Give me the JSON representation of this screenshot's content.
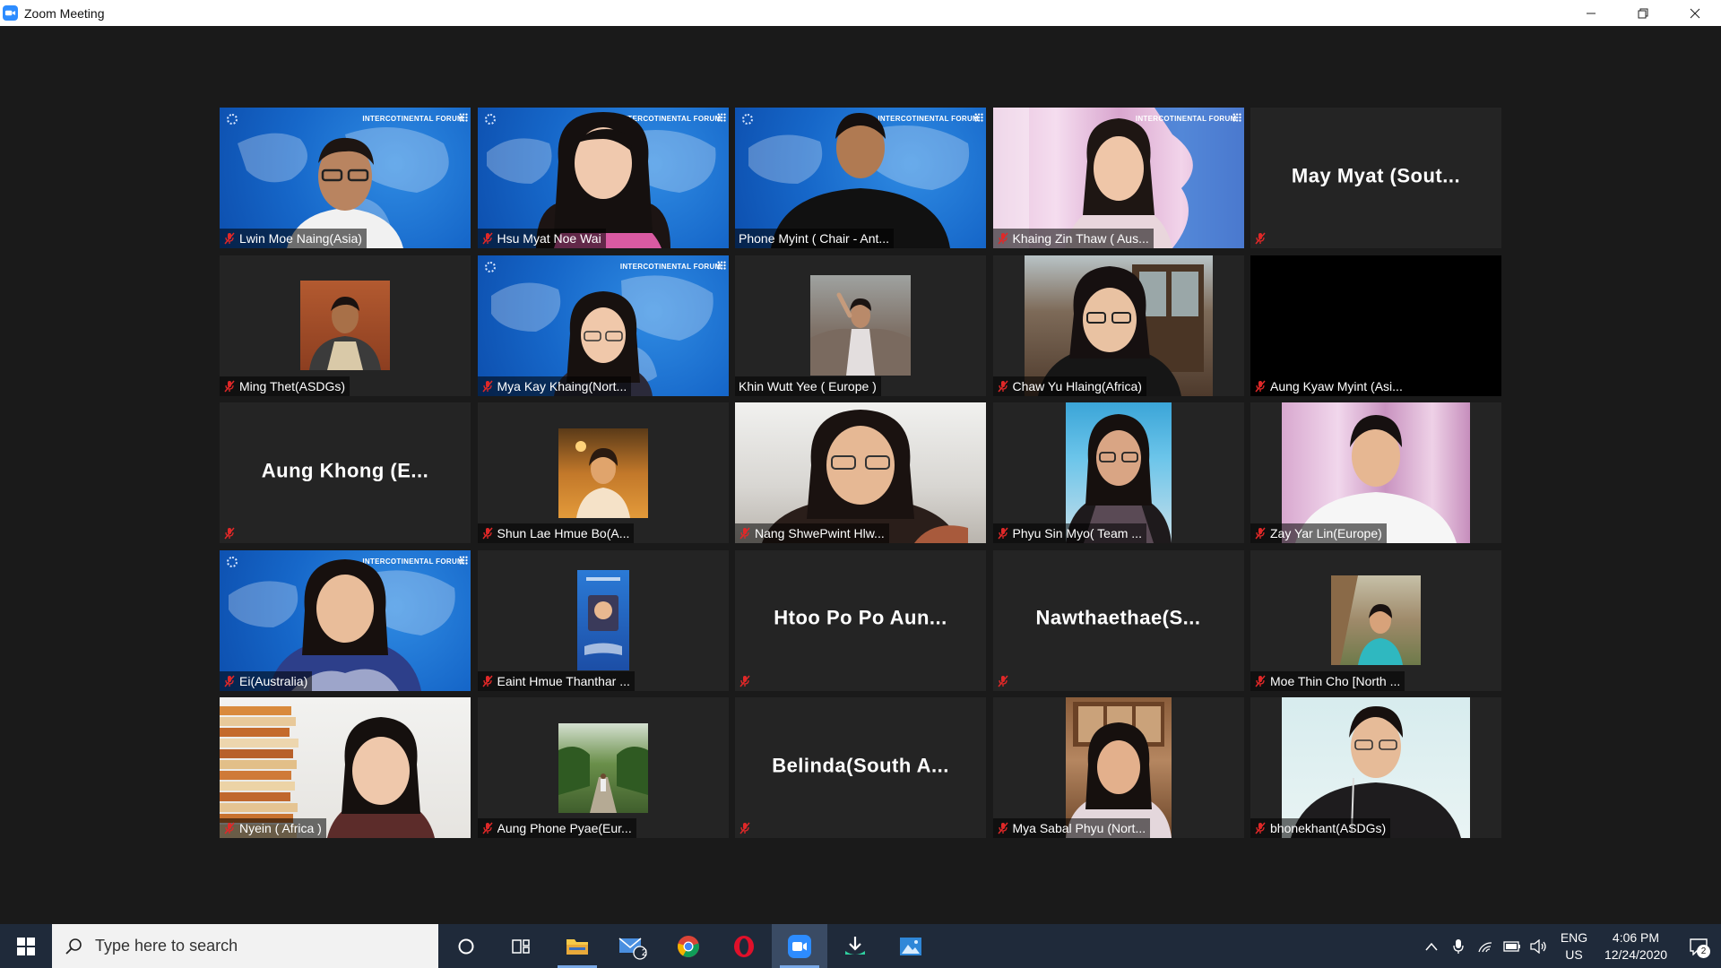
{
  "window": {
    "title": "Zoom Meeting",
    "controls": [
      "minimize",
      "restore",
      "close"
    ]
  },
  "participants": [
    {
      "name": "Lwin Moe Naing(Asia)",
      "muted": true,
      "video": "map"
    },
    {
      "name": "Hsu Myat Noe Wai",
      "muted": true,
      "video": "map"
    },
    {
      "name": "Phone Myint ( Chair - Ant...",
      "muted": false,
      "video": "map"
    },
    {
      "name": "Khaing Zin Thaw ( Aus...",
      "muted": true,
      "video": "curtain-map"
    },
    {
      "name": "May Myat (Sout...",
      "muted": true,
      "video": "none"
    },
    {
      "name": "Ming Thet(ASDGs)",
      "muted": true,
      "video": "photo"
    },
    {
      "name": "Mya Kay Khaing(Nort...",
      "muted": true,
      "video": "map"
    },
    {
      "name": "Khin Wutt Yee ( Europe )",
      "muted": false,
      "video": "photo"
    },
    {
      "name": "Chaw Yu Hlaing(Africa)",
      "muted": true,
      "video": "camera"
    },
    {
      "name": "Aung Kyaw Myint (Asi...",
      "muted": true,
      "video": "black"
    },
    {
      "name": "Aung Khong (E...",
      "muted": true,
      "video": "none"
    },
    {
      "name": "Shun Lae Hmue Bo(A...",
      "muted": true,
      "video": "photo"
    },
    {
      "name": "Nang ShwePwint Hlw...",
      "muted": true,
      "video": "camera"
    },
    {
      "name": "Phyu Sin Myo( Team ...",
      "muted": true,
      "video": "camera"
    },
    {
      "name": "Zay Yar Lin(Europe)",
      "muted": true,
      "video": "camera"
    },
    {
      "name": "Ei(Australia)",
      "muted": true,
      "video": "map"
    },
    {
      "name": "Eaint Hmue Thanthar ...",
      "muted": true,
      "video": "photo"
    },
    {
      "name": "Htoo Po Po Aun...",
      "muted": true,
      "video": "none"
    },
    {
      "name": "Nawthaethae(S...",
      "muted": true,
      "video": "none"
    },
    {
      "name": "Moe Thin Cho [North ...",
      "muted": true,
      "video": "photo"
    },
    {
      "name": "Nyein ( Africa )",
      "muted": true,
      "video": "camera"
    },
    {
      "name": "Aung Phone Pyae(Eur...",
      "muted": true,
      "video": "photo"
    },
    {
      "name": "Belinda(South A...",
      "muted": true,
      "video": "none"
    },
    {
      "name": "Mya Sabal Phyu (Nort...",
      "muted": true,
      "video": "camera"
    },
    {
      "name": "bhonekhant(ASDGs)",
      "muted": true,
      "video": "camera"
    }
  ],
  "virtual_background": {
    "brand": "INTERCOTINENTAL FORUM"
  },
  "taskbar": {
    "search_placeholder": "Type here to search",
    "mail_badge": "2",
    "language": "ENG",
    "region": "US",
    "time": "4:06 PM",
    "date": "12/24/2020",
    "notification_count": "2"
  },
  "colors": {
    "meeting_bg": "#1a1a1a",
    "tile_bg": "#242424",
    "mute_red": "#e02828",
    "zoom_blue": "#2d8cff",
    "taskbar_bg": "#1f2a3a"
  }
}
